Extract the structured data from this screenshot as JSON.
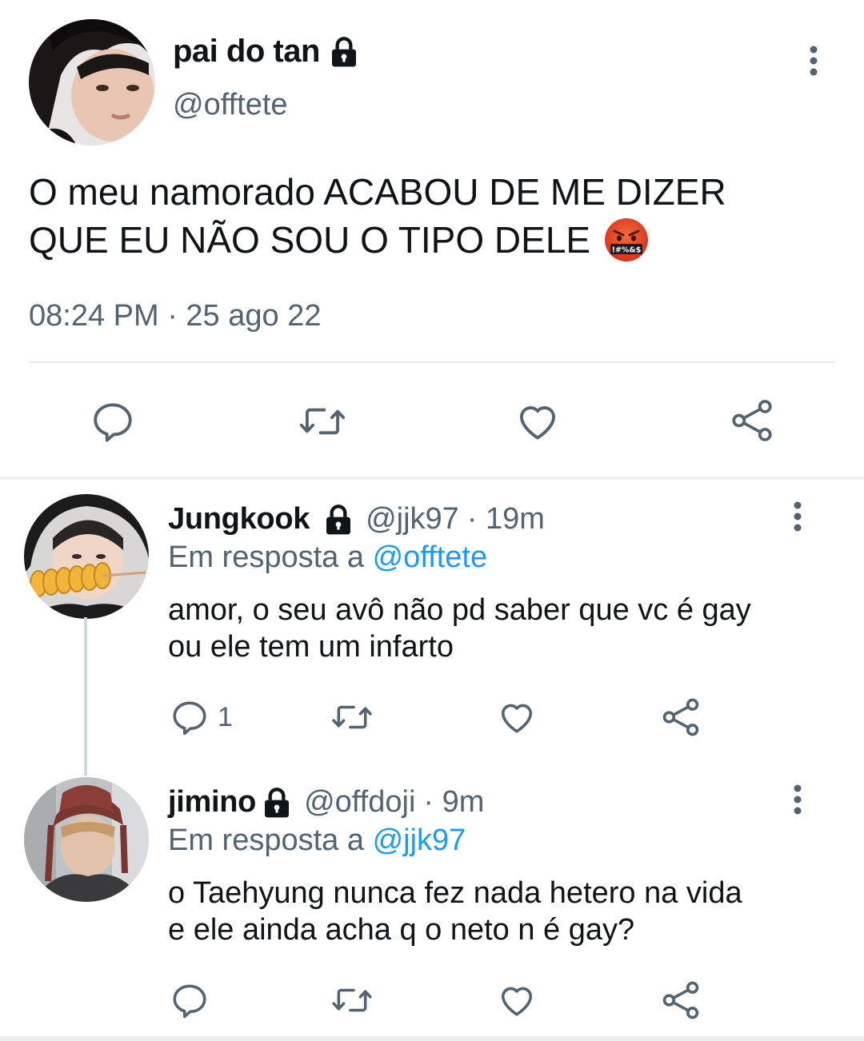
{
  "main_tweet": {
    "display_name": "pai do tan",
    "handle": "@offtete",
    "text_line1": "O meu namorado ACABOU DE ME DIZER",
    "text_line2": "QUE EU NÃO SOU O TIPO DELE",
    "emoji_text": "!#%&$",
    "timestamp": "08:24 PM · 25 ago 22"
  },
  "replies": [
    {
      "display_name": "Jungkook",
      "handle": "@jjk97",
      "time": "· 19m",
      "reply_prefix": "Em resposta a ",
      "reply_mention": "@offtete",
      "text_line1": "amor, o seu avô não pd saber que vc é gay",
      "text_line2": "ou ele tem um infarto",
      "reply_count": "1"
    },
    {
      "display_name": "jimino",
      "handle": "@offdoji",
      "time": "· 9m",
      "reply_prefix": "Em resposta a ",
      "reply_mention": "@jjk97",
      "text_line1": "o Taehyung nunca fez nada hetero na vida",
      "text_line2": "e ele ainda acha q o neto n é gay?",
      "reply_count": ""
    }
  ],
  "icons": [
    "lock-icon",
    "more-icon",
    "reply-icon",
    "retweet-icon",
    "like-icon",
    "share-icon"
  ],
  "colors": {
    "accent": "#1d9bf0",
    "muted": "#536471",
    "text": "#0f1419"
  }
}
